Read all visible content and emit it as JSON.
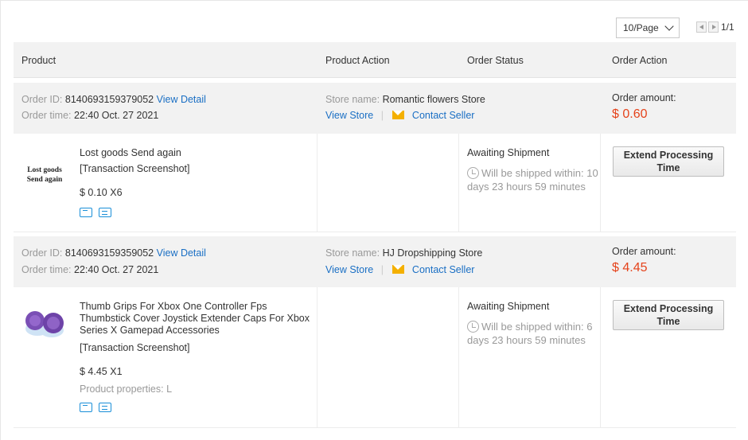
{
  "pager": {
    "page_size": "10/Page",
    "page_count": "1/1"
  },
  "table_headers": {
    "product": "Product",
    "product_action": "Product Action",
    "order_status": "Order Status",
    "order_action": "Order Action"
  },
  "labels": {
    "order_id": "Order ID:",
    "order_time": "Order time:",
    "view_detail": "View Detail",
    "store_name": "Store name:",
    "view_store": "View Store",
    "separator": "|",
    "contact_seller": "Contact Seller",
    "order_amount": "Order amount:",
    "extend_button": "Extend Processing Time"
  },
  "orders": [
    {
      "order_id": "8140693159379052",
      "order_time": "22:40 Oct. 27 2021",
      "store_name": "Romantic flowers Store",
      "amount": "$ 0.60",
      "product": {
        "name": "Lost goods Send again",
        "thumb_text": "Lost goods Send again",
        "screenshot_label": "[Transaction Screenshot]",
        "price_qty": "$ 0.10 X6",
        "properties": ""
      },
      "status": "Awaiting Shipment",
      "ship_note": "Will be shipped within: 10 days 23 hours 59 minutes"
    },
    {
      "order_id": "8140693159359052",
      "order_time": "22:40 Oct. 27 2021",
      "store_name": "HJ Dropshipping Store",
      "amount": "$ 4.45",
      "product": {
        "name": "Thumb Grips For Xbox One Controller Fps Thumbstick Cover Joystick Extender Caps For Xbox Series X Gamepad Accessories",
        "screenshot_label": "[Transaction Screenshot]",
        "price_qty": "$ 4.45 X1",
        "properties": "Product properties: L"
      },
      "status": "Awaiting Shipment",
      "ship_note": "Will be shipped within: 6 days 23 hours 59 minutes"
    }
  ],
  "colors": {
    "link": "#1a6fc4",
    "amount": "#e5431b",
    "header_bg": "#f2f2f2",
    "icon_blue": "#1a8fd8",
    "mail_yellow": "#f4b000",
    "thumb_purple": "#7a4fb5"
  },
  "icons": {
    "clock": "clock-icon",
    "mail": "mail-icon",
    "shipping": "truck-icon",
    "return": "return-icon"
  }
}
